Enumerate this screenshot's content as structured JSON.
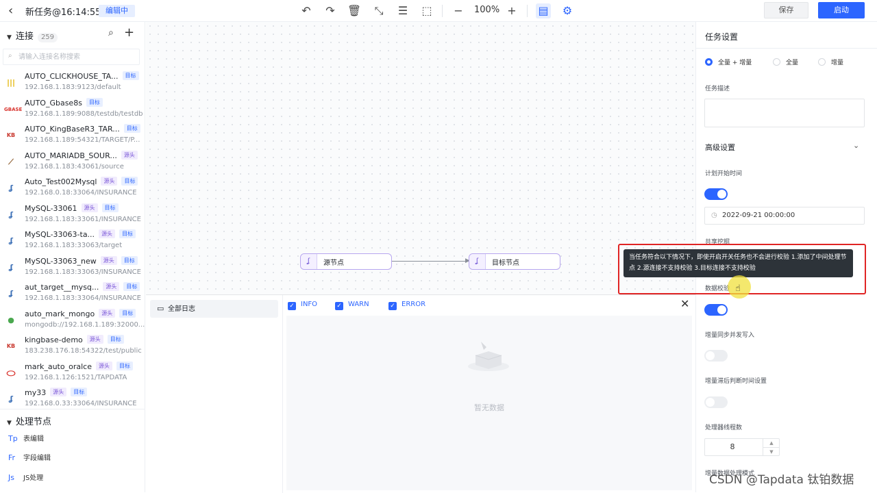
{
  "topbar": {
    "title": "新任务@16:14:55",
    "status_badge": "编辑中",
    "zoom": "100%",
    "save_label": "保存",
    "start_label": "启动"
  },
  "sidebar": {
    "connections_label": "连接",
    "connections_count": "259",
    "search_placeholder": "请输入连接名称搜索",
    "connections": [
      {
        "name": "AUTO_CLICKHOUSE_TA...",
        "address": "192.168.1.183:9123/default",
        "tags": [
          "目标"
        ],
        "icon": "clickhouse-icon"
      },
      {
        "name": "AUTO_Gbase8s",
        "address": "192.168.1.189:9088/testdb/testdb",
        "tags": [
          "目标"
        ],
        "icon": "gbase-icon"
      },
      {
        "name": "AUTO_KingBaseR3_TAR...",
        "address": "192.168.1.189:54321/TARGET/P...",
        "tags": [
          "目标"
        ],
        "icon": "kingbase-icon"
      },
      {
        "name": "AUTO_MARIADB_SOUR...",
        "address": "192.168.1.183:43061/source",
        "tags": [
          "源头"
        ],
        "icon": "mariadb-icon"
      },
      {
        "name": "Auto_Test002Mysql",
        "address": "192.168.0.18:33064/INSURANCE",
        "tags": [
          "源头",
          "目标"
        ],
        "icon": "mysql-icon"
      },
      {
        "name": "MySQL-33061",
        "address": "192.168.1.183:33061/INSURANCE",
        "tags": [
          "源头",
          "目标"
        ],
        "icon": "mysql-icon"
      },
      {
        "name": "MySQL-33063-ta...",
        "address": "192.168.1.183:33063/target",
        "tags": [
          "源头",
          "目标"
        ],
        "icon": "mysql-icon"
      },
      {
        "name": "MySQL-33063_new",
        "address": "192.168.1.183:33063/INSURANCE",
        "tags": [
          "源头",
          "目标"
        ],
        "icon": "mysql-icon"
      },
      {
        "name": "aut_target__mysq...",
        "address": "192.168.1.183:33064/INSURANCE",
        "tags": [
          "源头",
          "目标"
        ],
        "icon": "mysql-icon"
      },
      {
        "name": "auto_mark_mongo",
        "address": "mongodb://192.168.1.189:32000...",
        "tags": [
          "源头",
          "目标"
        ],
        "icon": "mongodb-icon"
      },
      {
        "name": "kingbase-demo",
        "address": "183.238.176.18:54322/test/public",
        "tags": [
          "源头",
          "目标"
        ],
        "icon": "kingbase-icon"
      },
      {
        "name": "mark_auto_oralce",
        "address": "192.168.1.126:1521/TAPDATA",
        "tags": [
          "源头",
          "目标"
        ],
        "icon": "oracle-icon"
      },
      {
        "name": "my33",
        "address": "192.168.0.33:33064/INSURANCE",
        "tags": [
          "源头",
          "目标"
        ],
        "icon": "mysql-icon"
      }
    ],
    "processing_label": "处理节点",
    "processing_nodes": [
      {
        "icon_text": "Tp",
        "label": "表编辑"
      },
      {
        "icon_text": "Fr",
        "label": "字段编辑"
      },
      {
        "icon_text": "Js",
        "label": "JS处理"
      }
    ]
  },
  "canvas": {
    "source_node": "源节点",
    "target_node": "目标节点"
  },
  "log_panel": {
    "all_logs": "全部日志",
    "levels": [
      "INFO",
      "WARN",
      "ERROR"
    ],
    "empty_text": "暂无数据"
  },
  "settings": {
    "title": "任务设置",
    "sync_types": [
      "全量 + 增量",
      "全量",
      "增量"
    ],
    "selected_sync_type": "全量 + 增量",
    "description_label": "任务描述",
    "advanced_label": "高级设置",
    "schedule_label": "计划开始时间",
    "schedule_time": "2022-09-21 00:00:00",
    "shared_mining_label": "共享挖掘",
    "data_check_label": "数据校验",
    "incremental_write_label": "增量同步并发写入",
    "lag_label": "增量滞后判断时间设置",
    "threads_label": "处理器线程数",
    "threads_value": "8",
    "incremental_mode_label": "增量数据处理模式"
  },
  "tooltip": {
    "text": "当任务符合以下情况下，即使开启开关任务也不会进行校验 1.添加了中间处理节点 2.源连接不支持校验 3.目标连接不支持校验"
  },
  "watermark": "CSDN @Tapdata 钛铂数据",
  "colors": {
    "primary": "#2c65ff",
    "highlight_border": "#e02424",
    "source_tag": "#7a56d8"
  }
}
